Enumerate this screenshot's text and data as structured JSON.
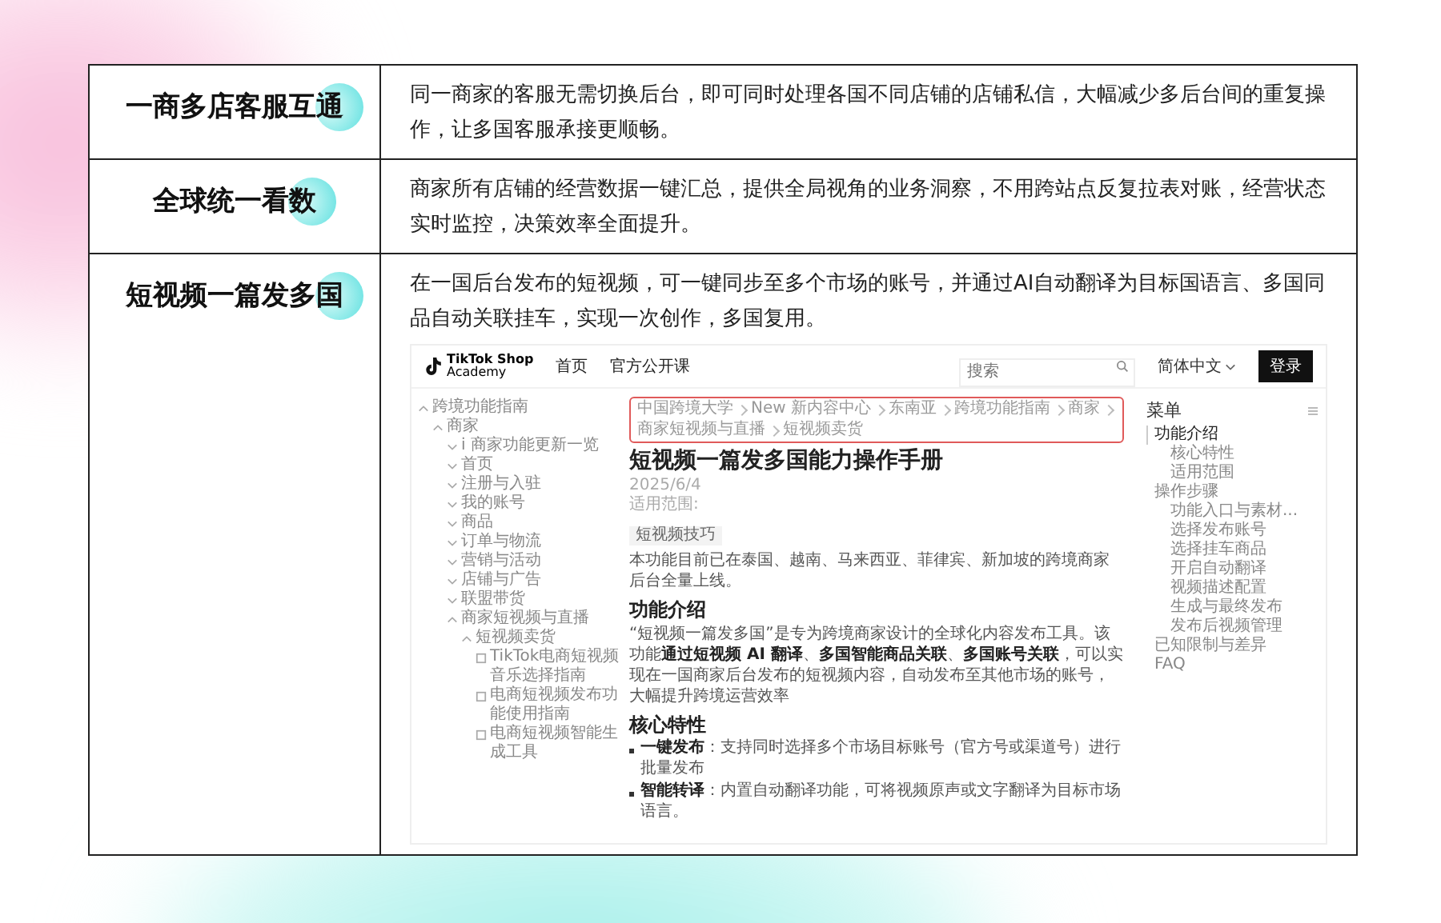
{
  "rows": [
    {
      "heading": "一商多店客服互通",
      "text": "同一商家的客服无需切换后台，即可同时处理各国不同店铺的店铺私信，大幅减少多后台间的重复操作，让多国客服承接更顺畅。"
    },
    {
      "heading": "全球统一看数",
      "text": "商家所有店铺的经营数据一键汇总，提供全局视角的业务洞察，不用跨站点反复拉表对账，经营状态实时监控，决策效率全面提升。"
    },
    {
      "heading": "短视频一篇发多国",
      "text": "在一国后台发布的短视频，可一键同步至多个市场的账号，并通过AI自动翻译为目标国语言、多国同品自动关联挂车，实现一次创作，多国复用。"
    }
  ],
  "embedded_page": {
    "nav": {
      "logo_line_1": "TikTok Shop",
      "logo_line_2": "Academy",
      "links": [
        "首页",
        "官方公开课"
      ],
      "search": {
        "placeholder": "搜索"
      },
      "language": "简体中文",
      "login": "登录"
    },
    "sidebar": [
      {
        "label": "跨境功能指南",
        "kind": "group",
        "expanded": true,
        "children": [
          {
            "label": "商家",
            "kind": "group",
            "expanded": true,
            "children": [
              {
                "label": "i 商家功能更新一览",
                "kind": "group",
                "expanded": false
              },
              {
                "label": "首页",
                "kind": "group",
                "expanded": false
              },
              {
                "label": "注册与入驻",
                "kind": "group",
                "expanded": false
              },
              {
                "label": "我的账号",
                "kind": "group",
                "expanded": false
              },
              {
                "label": "商品",
                "kind": "group",
                "expanded": false
              },
              {
                "label": "订单与物流",
                "kind": "group",
                "expanded": false
              },
              {
                "label": "营销与活动",
                "kind": "group",
                "expanded": false
              },
              {
                "label": "店铺与广告",
                "kind": "group",
                "expanded": false
              },
              {
                "label": "联盟带货",
                "kind": "group",
                "expanded": false
              },
              {
                "label": "商家短视频与直播",
                "kind": "group",
                "expanded": true,
                "children": [
                  {
                    "label": "短视频卖货",
                    "kind": "group",
                    "expanded": true,
                    "children": [
                      {
                        "label": "TikTok电商短视频音乐选择指南",
                        "kind": "page"
                      },
                      {
                        "label": "电商短视频发布功能使用指南",
                        "kind": "page"
                      },
                      {
                        "label": "电商短视频智能生成工具",
                        "kind": "page"
                      }
                    ]
                  }
                ]
              }
            ]
          }
        ]
      }
    ],
    "breadcrumb": [
      "中国跨境大学",
      "New 新内容中心",
      "东南亚",
      "跨境功能指南",
      "商家",
      "商家短视频与直播",
      "短视频卖货"
    ],
    "title": "短视频一篇发多国能力操作手册",
    "date": "2025/6/4",
    "scope_label": "适用范围:",
    "tag": "短视频技巧",
    "intro": "本功能目前已在泰国、越南、马来西亚、菲律宾、新加坡的跨境商家后台全量上线。",
    "sections": [
      {
        "heading": "功能介绍",
        "kind": "paragraph",
        "text": "“短视频一篇发多国”是专为跨境商家设计的全球化内容发布工具。该功能**通过短视频 AI 翻译**、**多国智能商品关联**、**多国账号关联**，可以实现在一国商家后台发布的短视频内容，自动发布至其他市场的账号，大幅提升跨境运营效率"
      },
      {
        "heading": "核心特性",
        "kind": "bullets",
        "items": [
          "**一键发布**：支持同时选择多个市场目标账号（官方号或渠道号）进行批量发布",
          "**智能转译**：内置自动翻译功能，可将视频原声或文字翻译为目标市场语言。"
        ]
      }
    ],
    "menu": {
      "title": "菜单",
      "items": [
        {
          "label": "功能介绍",
          "selected": true,
          "children": [
            {
              "label": "核心特性",
              "selected": false
            },
            {
              "label": "适用范围",
              "selected": false
            }
          ]
        },
        {
          "label": "操作步骤",
          "selected": false,
          "children": [
            {
              "label": "功能入口与素材...",
              "selected": false
            },
            {
              "label": "选择发布账号",
              "selected": false
            },
            {
              "label": "选择挂车商品",
              "selected": false
            },
            {
              "label": "开启自动翻译",
              "selected": false
            },
            {
              "label": "视频描述配置",
              "selected": false
            },
            {
              "label": "生成与最终发布",
              "selected": false
            },
            {
              "label": "发布后视频管理",
              "selected": false
            }
          ]
        },
        {
          "label": "已知限制与差异",
          "selected": false
        },
        {
          "label": "FAQ",
          "selected": false
        }
      ]
    }
  }
}
